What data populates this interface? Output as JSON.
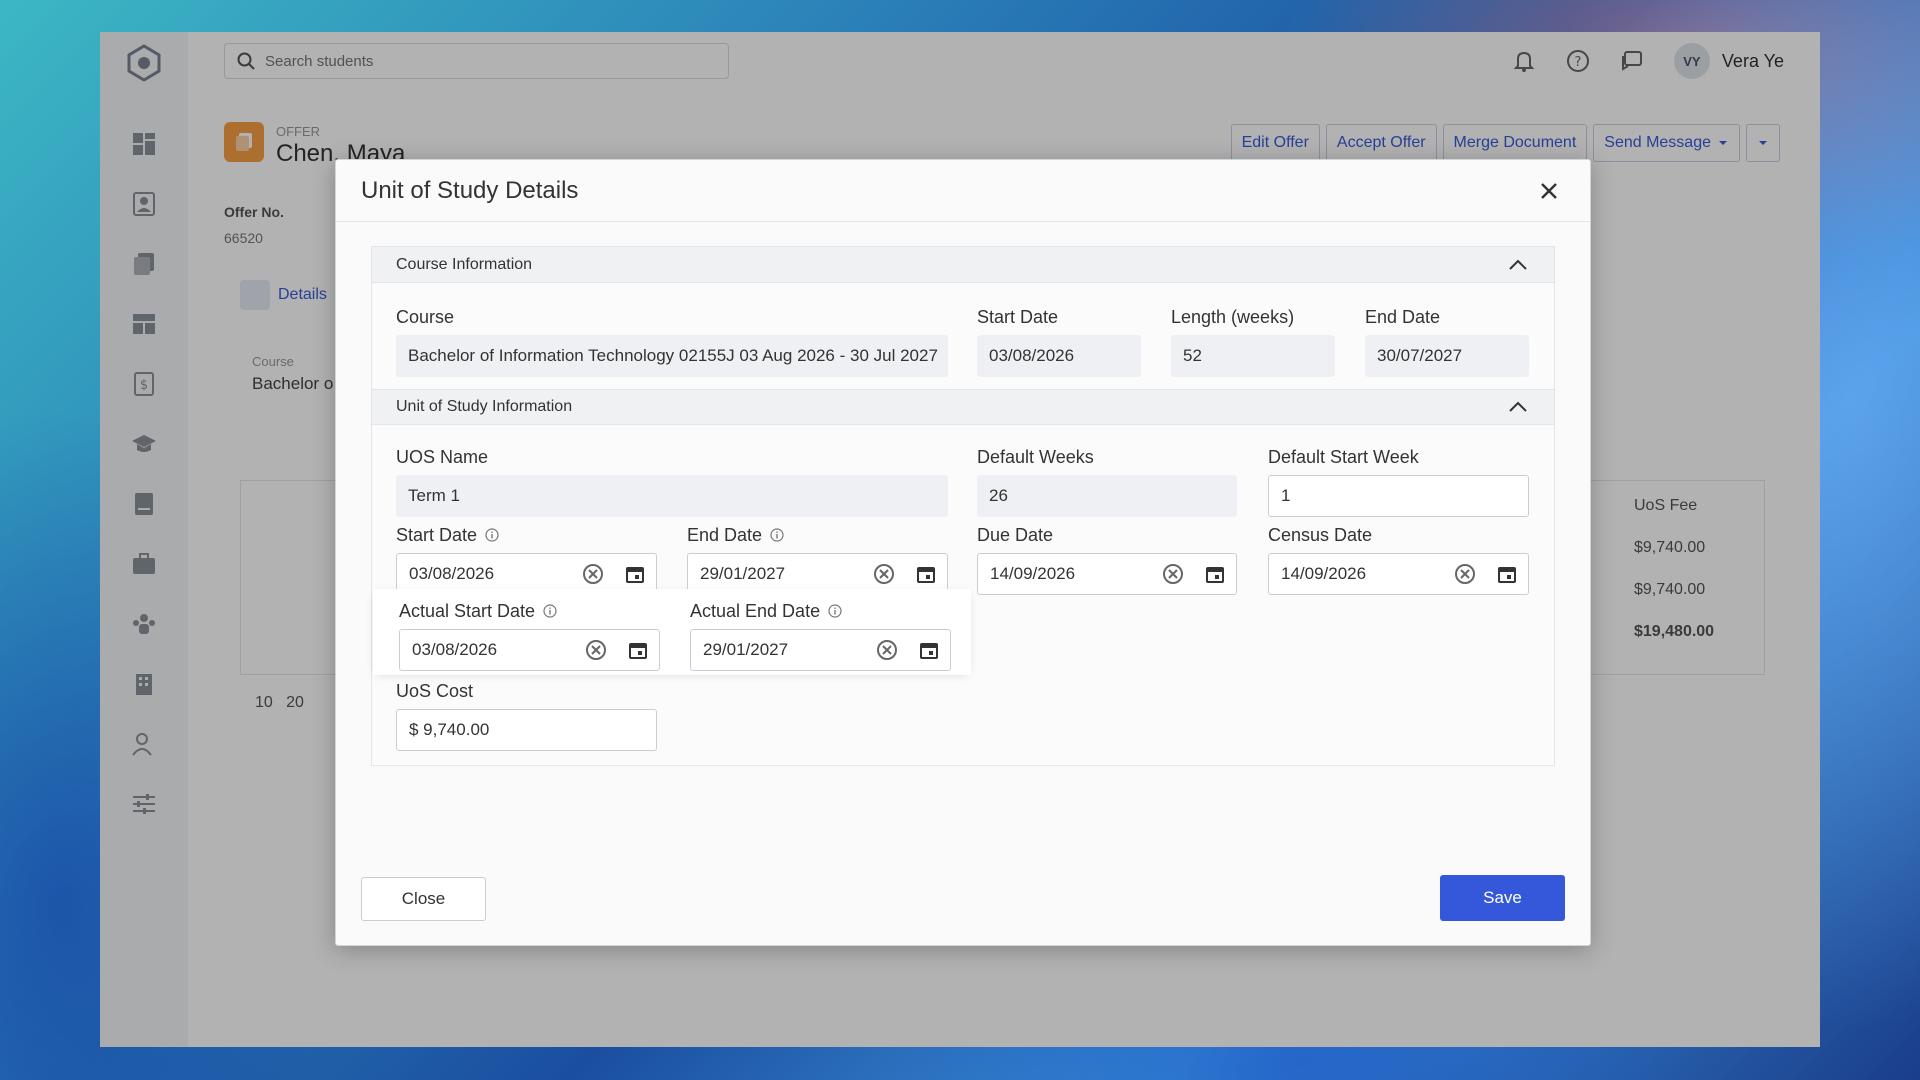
{
  "topbar": {
    "search_placeholder": "Search students",
    "user_initials": "VY",
    "user_name": "Vera Ye"
  },
  "page": {
    "kind": "OFFER",
    "name": "Chen, Maya",
    "offer_no_label": "Offer No.",
    "offer_no": "66520",
    "buttons": [
      "Edit Offer",
      "Accept Offer",
      "Merge Document",
      "Send Message"
    ],
    "tab_details": "Details",
    "bg_course_label": "Course",
    "bg_course_value": "Bachelor o",
    "fee_header": "UoS Fee",
    "fees": [
      "$9,740.00",
      "$9,740.00",
      "$19,480.00"
    ],
    "pager": "10   20"
  },
  "modal": {
    "title": "Unit of Study Details",
    "course_section": {
      "title": "Course Information",
      "course_label": "Course",
      "course_value": "Bachelor of Information Technology 02155J 03 Aug 2026 - 30 Jul 2027",
      "start_label": "Start Date",
      "start_value": "03/08/2026",
      "length_label": "Length (weeks)",
      "length_value": "52",
      "end_label": "End Date",
      "end_value": "30/07/2027"
    },
    "uos_section": {
      "title": "Unit of Study Information",
      "name_label": "UOS Name",
      "name_value": "Term 1",
      "default_weeks_label": "Default Weeks",
      "default_weeks_value": "26",
      "default_start_week_label": "Default Start Week",
      "default_start_week_value": "1",
      "start_label": "Start Date",
      "start_value": "03/08/2026",
      "end_label": "End Date",
      "end_value": "29/01/2027",
      "due_label": "Due Date",
      "due_value": "14/09/2026",
      "census_label": "Census Date",
      "census_value": "14/09/2026",
      "actual_start_label": "Actual Start Date",
      "actual_start_value": "03/08/2026",
      "actual_end_label": "Actual End Date",
      "actual_end_value": "29/01/2027",
      "cost_label": "UoS Cost",
      "cost_value": "$ 9,740.00"
    },
    "close_label": "Close",
    "save_label": "Save"
  },
  "colors": {
    "accent": "#3458d9",
    "offer_icon": "#f7a046"
  }
}
